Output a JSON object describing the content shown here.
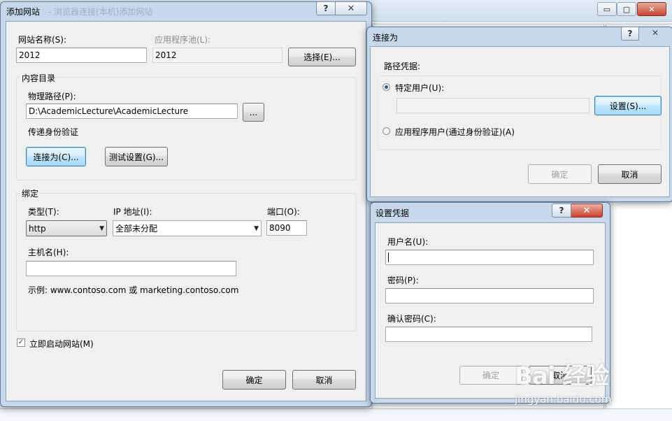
{
  "add_site": {
    "title": "添加网站",
    "title_obscured": "- 浏览器连接(本机)添加网站",
    "site_name_label": "网站名称(S):",
    "site_name_value": "2012",
    "app_pool_label": "应用程序池(L):",
    "app_pool_value": "2012",
    "select_button": "选择(E)...",
    "content_dir_legend": "内容目录",
    "physical_path_label": "物理路径(P):",
    "physical_path_value": "D:\\AcademicLecture\\AcademicLecture",
    "browse_button": "...",
    "pass_through_label": "传递身份验证",
    "connect_as_button": "连接为(C)...",
    "test_settings_button": "测试设置(G)...",
    "binding_legend": "绑定",
    "type_label": "类型(T):",
    "type_value": "http",
    "ip_label": "IP 地址(I):",
    "ip_value": "全部未分配",
    "port_label": "端口(O):",
    "port_value": "8090",
    "hostname_label": "主机名(H):",
    "hostname_value": "",
    "example_text": "示例: www.contoso.com 或 marketing.contoso.com",
    "start_now_label": "立即启动网站(M)",
    "start_now_checked": true,
    "ok_button": "确定",
    "cancel_button": "取消"
  },
  "connect_as": {
    "title": "连接为",
    "path_credentials_label": "路径凭据:",
    "specific_user_label": "特定用户(U):",
    "specific_user_selected": true,
    "user_value": "",
    "set_button": "设置(S)...",
    "app_user_label": "应用程序用户(通过身份验证)(A)",
    "ok_button": "确定",
    "cancel_button": "取消"
  },
  "set_credentials": {
    "title": "设置凭据",
    "username_label": "用户名(U):",
    "username_value": "",
    "password_label": "密码(P):",
    "password_value": "",
    "confirm_password_label": "确认密码(C):",
    "confirm_password_value": "",
    "ok_button": "确定",
    "cancel_button": "取消"
  },
  "watermark": {
    "brand": "Bai 经验",
    "url": "jingyan.baidu.com"
  },
  "icons": {
    "help": "?",
    "close": "✕",
    "minimize": "▭",
    "maximize": "▢",
    "dropdown": "▼",
    "check": "✓"
  }
}
